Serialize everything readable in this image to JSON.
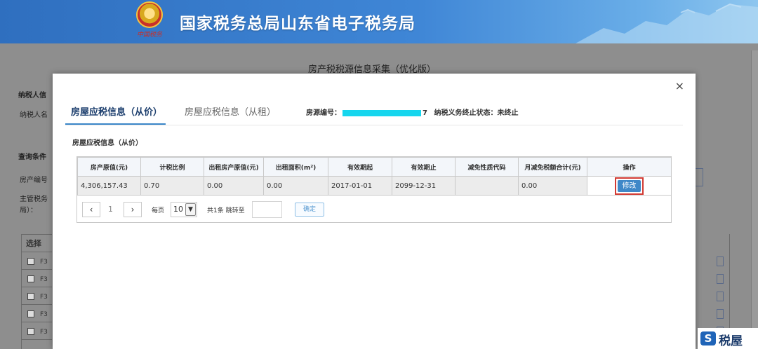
{
  "header": {
    "site_title": "国家税务总局山东省电子税务局",
    "emblem_script": "中国税务"
  },
  "background": {
    "page_title": "房产税税源信息采集（优化版）",
    "labels": {
      "taxpayer_info": "纳税人信",
      "taxpayer_name": "纳税人名",
      "query_conditions": "查询条件",
      "property_no": "房产编号",
      "authority_line1": "主管税务",
      "authority_line2": "局）："
    },
    "table": {
      "select_header": "选择",
      "rows": [
        "F3",
        "F3",
        "F3",
        "F3",
        "F3"
      ]
    }
  },
  "modal": {
    "close": "×",
    "tabs": [
      {
        "label": "房屋应税信息（从价）",
        "active": true
      },
      {
        "label": "房屋应税信息（从租）",
        "active": false
      }
    ],
    "meta": {
      "source_label": "房源编号：",
      "source_suffix": "7",
      "status_label": "纳税义务终止状态：",
      "status_value": "未终止"
    },
    "section_title": "房屋应税信息（从价）",
    "table": {
      "headers": [
        "房产原值(元)",
        "计税比例",
        "出租房产原值(元)",
        "出租面积(m²)",
        "有效期起",
        "有效期止",
        "减免性质代码",
        "月减免税额合计(元)",
        "操作"
      ],
      "rows": [
        [
          "4,306,157.43",
          "0.70",
          "0.00",
          "0.00",
          "2017-01-01",
          "2099-12-31",
          "",
          "0.00"
        ]
      ],
      "edit_label": "修改"
    },
    "pager": {
      "prev": "‹",
      "current_page": "1",
      "next": "›",
      "per_page_label": "每页",
      "page_size": "10",
      "total_label": "共1条 跳转至",
      "confirm": "确定"
    }
  },
  "watermark": {
    "logo_letter": "S",
    "text": "税屋"
  }
}
